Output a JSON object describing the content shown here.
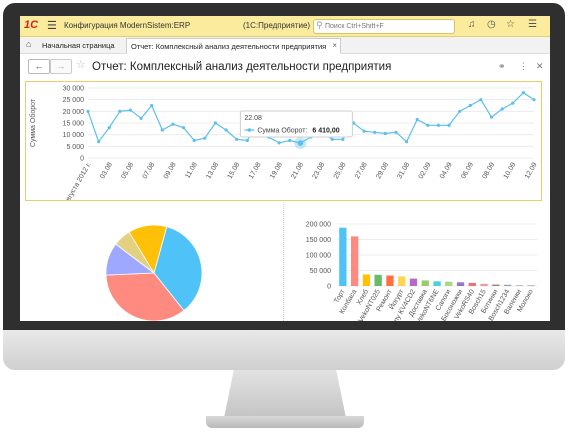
{
  "app": {
    "logo": "1С",
    "title": "Конфигурация ModernSistem:ERP",
    "mode": "(1С:Предприятие)",
    "search_placeholder": "Поиск Ctrl+Shift+F"
  },
  "tabs": {
    "home": "Начальная страница",
    "report": "Отчет: Комплексный анализ деятельности предприятия"
  },
  "report": {
    "title": "Отчет: Комплексный анализ деятельности предприятия"
  },
  "icons": {
    "menu": "hamburger-icon",
    "bell": "bell-icon",
    "history": "history-icon",
    "star": "star-icon",
    "settings": "settings-icon",
    "home": "home-icon",
    "link": "link-icon",
    "more": "more-icon",
    "close": "close-icon"
  },
  "colors": {
    "accent_bar": "#fbeb9c",
    "line": "#5bc0eb",
    "frame": "#e8cf6a"
  },
  "chart_data": [
    {
      "type": "line",
      "ylabel": "Сумма Оборот",
      "ylim": [
        0,
        30000
      ],
      "yticks": [
        "30 000",
        "25 000",
        "20 000",
        "15 000",
        "10 000",
        "5 000",
        "0"
      ],
      "xticks": [
        "1 августа 2012 г.",
        "03.08",
        "05.08",
        "07.08",
        "09.08",
        "11.08",
        "13.08",
        "15.08",
        "17.08",
        "19.08",
        "21.08",
        "23.08",
        "25.08",
        "27.08",
        "29.08",
        "31.08",
        "02.09",
        "04.09",
        "06.09",
        "08.09",
        "10.09",
        "12.09"
      ],
      "values": [
        20000,
        7000,
        13000,
        20000,
        20500,
        17000,
        22500,
        12000,
        14500,
        13000,
        7500,
        8500,
        15000,
        12000,
        8000,
        7500,
        16000,
        9000,
        6500,
        7500,
        6410,
        9000,
        11500,
        8000,
        8000,
        15000,
        11500,
        11000,
        10500,
        11000,
        7000,
        16500,
        14000,
        14000,
        14000,
        20000,
        22500,
        25000,
        17500,
        21000,
        23500,
        28000,
        25000
      ],
      "tooltip": {
        "date": "22.08",
        "series": "Сумма Оборот:",
        "value": "6 410,00"
      },
      "tooltip_index": 20
    },
    {
      "type": "pie",
      "slices": [
        {
          "value": 35,
          "color": "#4fc3f7"
        },
        {
          "value": 35,
          "color": "#ff8a80"
        },
        {
          "value": 11,
          "color": "#9fa8ff"
        },
        {
          "value": 6,
          "color": "#e3d080"
        },
        {
          "value": 13,
          "color": "#ffc107"
        }
      ]
    },
    {
      "type": "bar",
      "ylim": [
        0,
        200000
      ],
      "yticks": [
        "200 000",
        "150 000",
        "100 000",
        "50 000",
        "0"
      ],
      "categories": [
        "Торт",
        "Колбаса",
        "Хлеб",
        "VekoNT025",
        "Ремонт",
        "Йогурт",
        "Sony KV4CD2",
        "Доставка",
        "VekoNT6NE",
        "Сапоги",
        "Босоножки",
        "VekoRS40",
        "Bosch15",
        "Ботинки",
        "Bosch1234",
        "Валенки",
        "Молоко"
      ],
      "values": [
        188000,
        160000,
        37000,
        36000,
        34000,
        31000,
        24000,
        18000,
        15000,
        14000,
        12000,
        10000,
        7000,
        5000,
        4000,
        3000,
        2500
      ],
      "colors": [
        "#4fc3f7",
        "#ff8a80",
        "#ffc107",
        "#66bb6a",
        "#ff7043",
        "#ffd54f",
        "#ba68c8",
        "#9ccc65",
        "#4dd0e1",
        "#aed581",
        "#9575cd",
        "#e57373",
        "#ef9a9a",
        "#a1887f",
        "#90a4ae",
        "#b0bec5",
        "#bcaaa4"
      ]
    }
  ]
}
